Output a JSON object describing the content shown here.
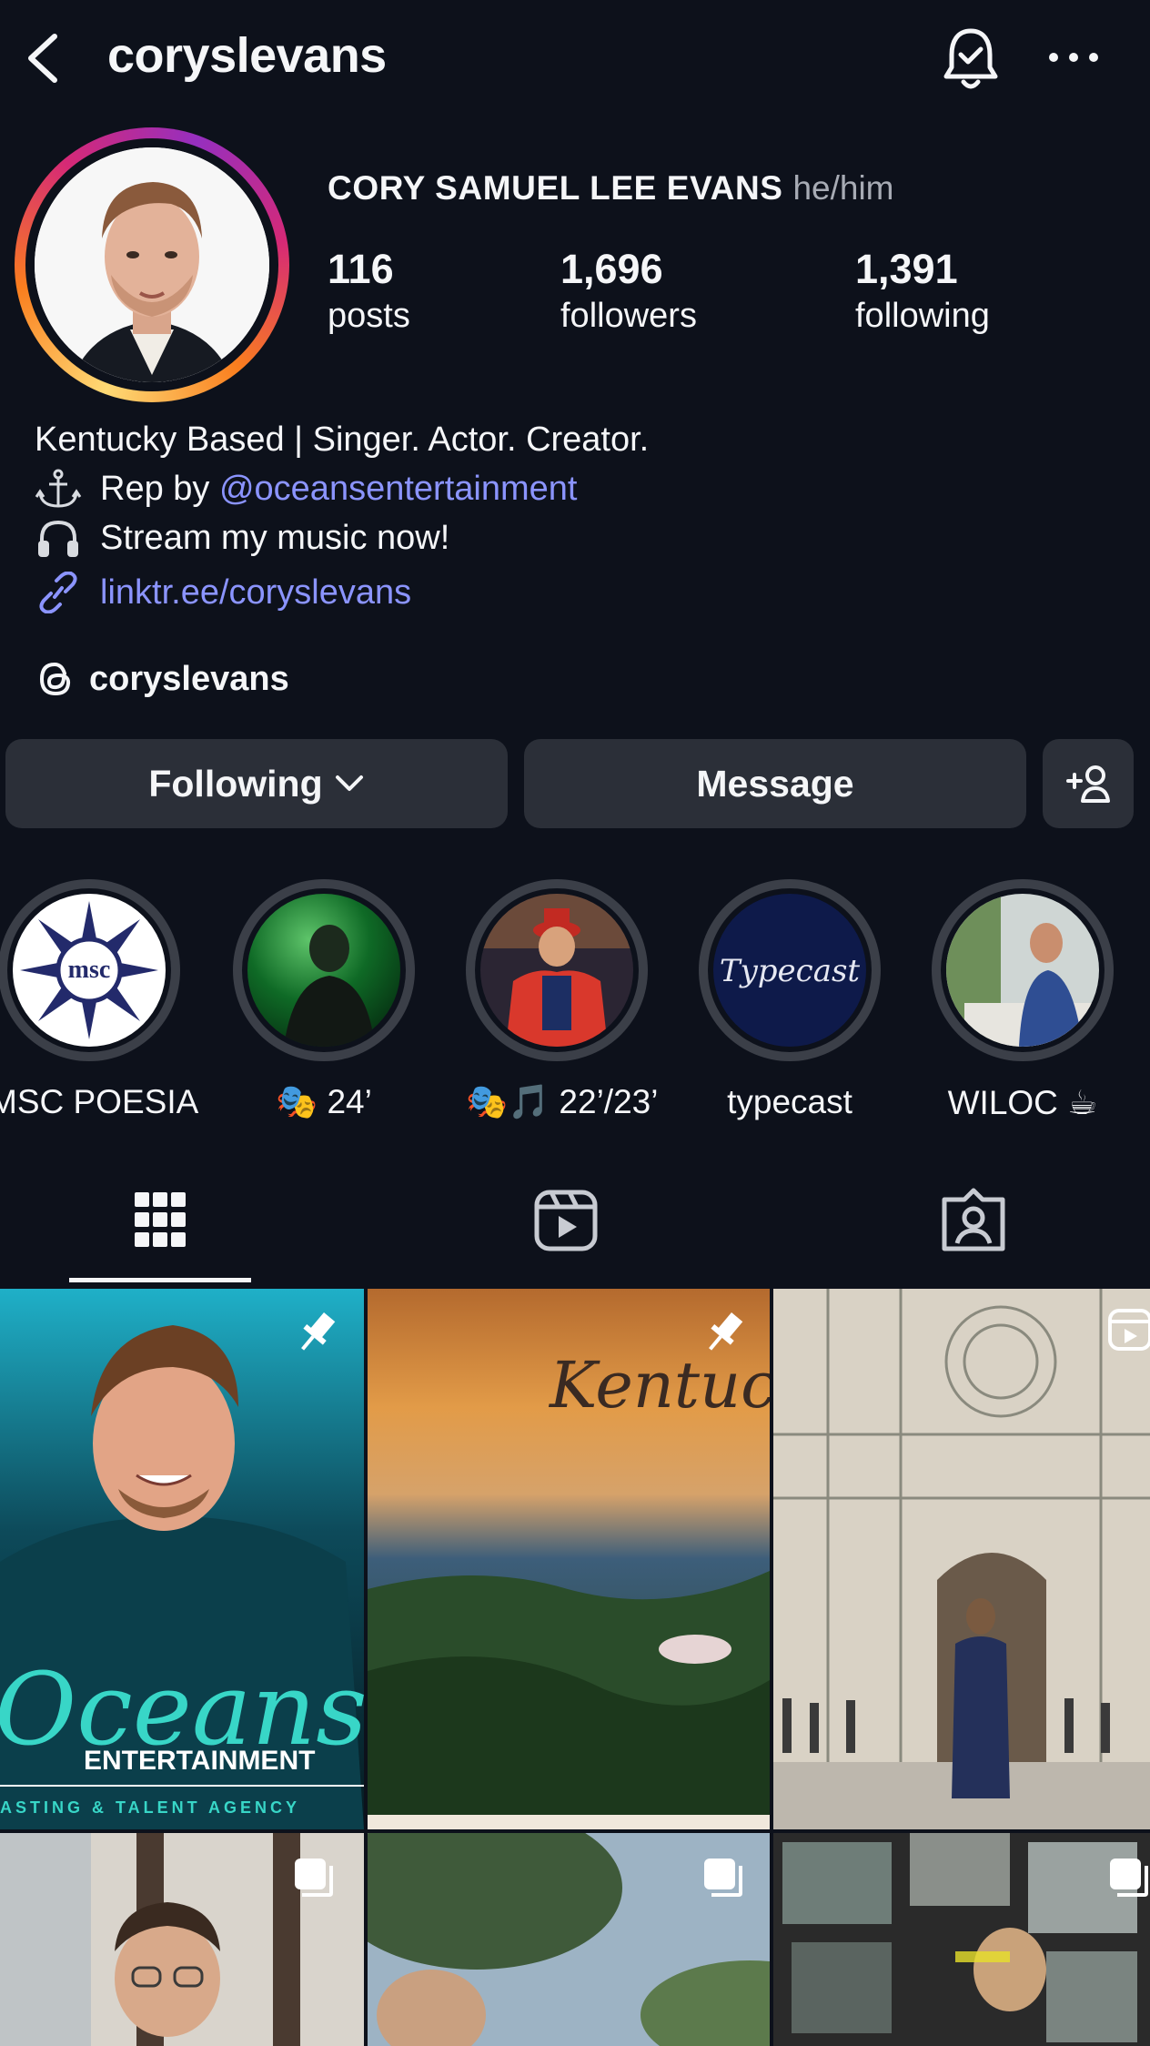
{
  "header": {
    "username": "coryslevans"
  },
  "profile": {
    "full_name": "CORY SAMUEL LEE EVANS",
    "pronouns": "he/him",
    "stats": [
      {
        "value": "116",
        "label": "posts"
      },
      {
        "value": "1,696",
        "label": "followers"
      },
      {
        "value": "1,391",
        "label": "following"
      }
    ],
    "bio": {
      "line1": "Kentucky Based | Singer. Actor. Creator.",
      "line2_prefix": "Rep by",
      "line2_mention": "@oceansentertainment",
      "line3": "Stream my music now!",
      "link": "linktr.ee/coryslevans"
    },
    "threads_handle": "coryslevans"
  },
  "actions": {
    "following_label": "Following",
    "message_label": "Message"
  },
  "highlights": [
    {
      "label": "MSC POESIA"
    },
    {
      "label": "🎭 24’"
    },
    {
      "label": "🎭🎵 22’/23’"
    },
    {
      "label": "typecast"
    },
    {
      "label": "WILOC ☕"
    }
  ],
  "posts": {
    "tile1_title": "Oceans",
    "tile1_subtitle": "ENTERTAINMENT",
    "tile1_tagline": "ASTING & TALENT AGENCY",
    "tile2_script": "Kentuck"
  },
  "highlight_art": {
    "msc_text": "msc",
    "typecast_text": "Typecast"
  },
  "colors": {
    "background": "#0d111b",
    "button": "#2b2f38",
    "link": "#8b94ff"
  }
}
